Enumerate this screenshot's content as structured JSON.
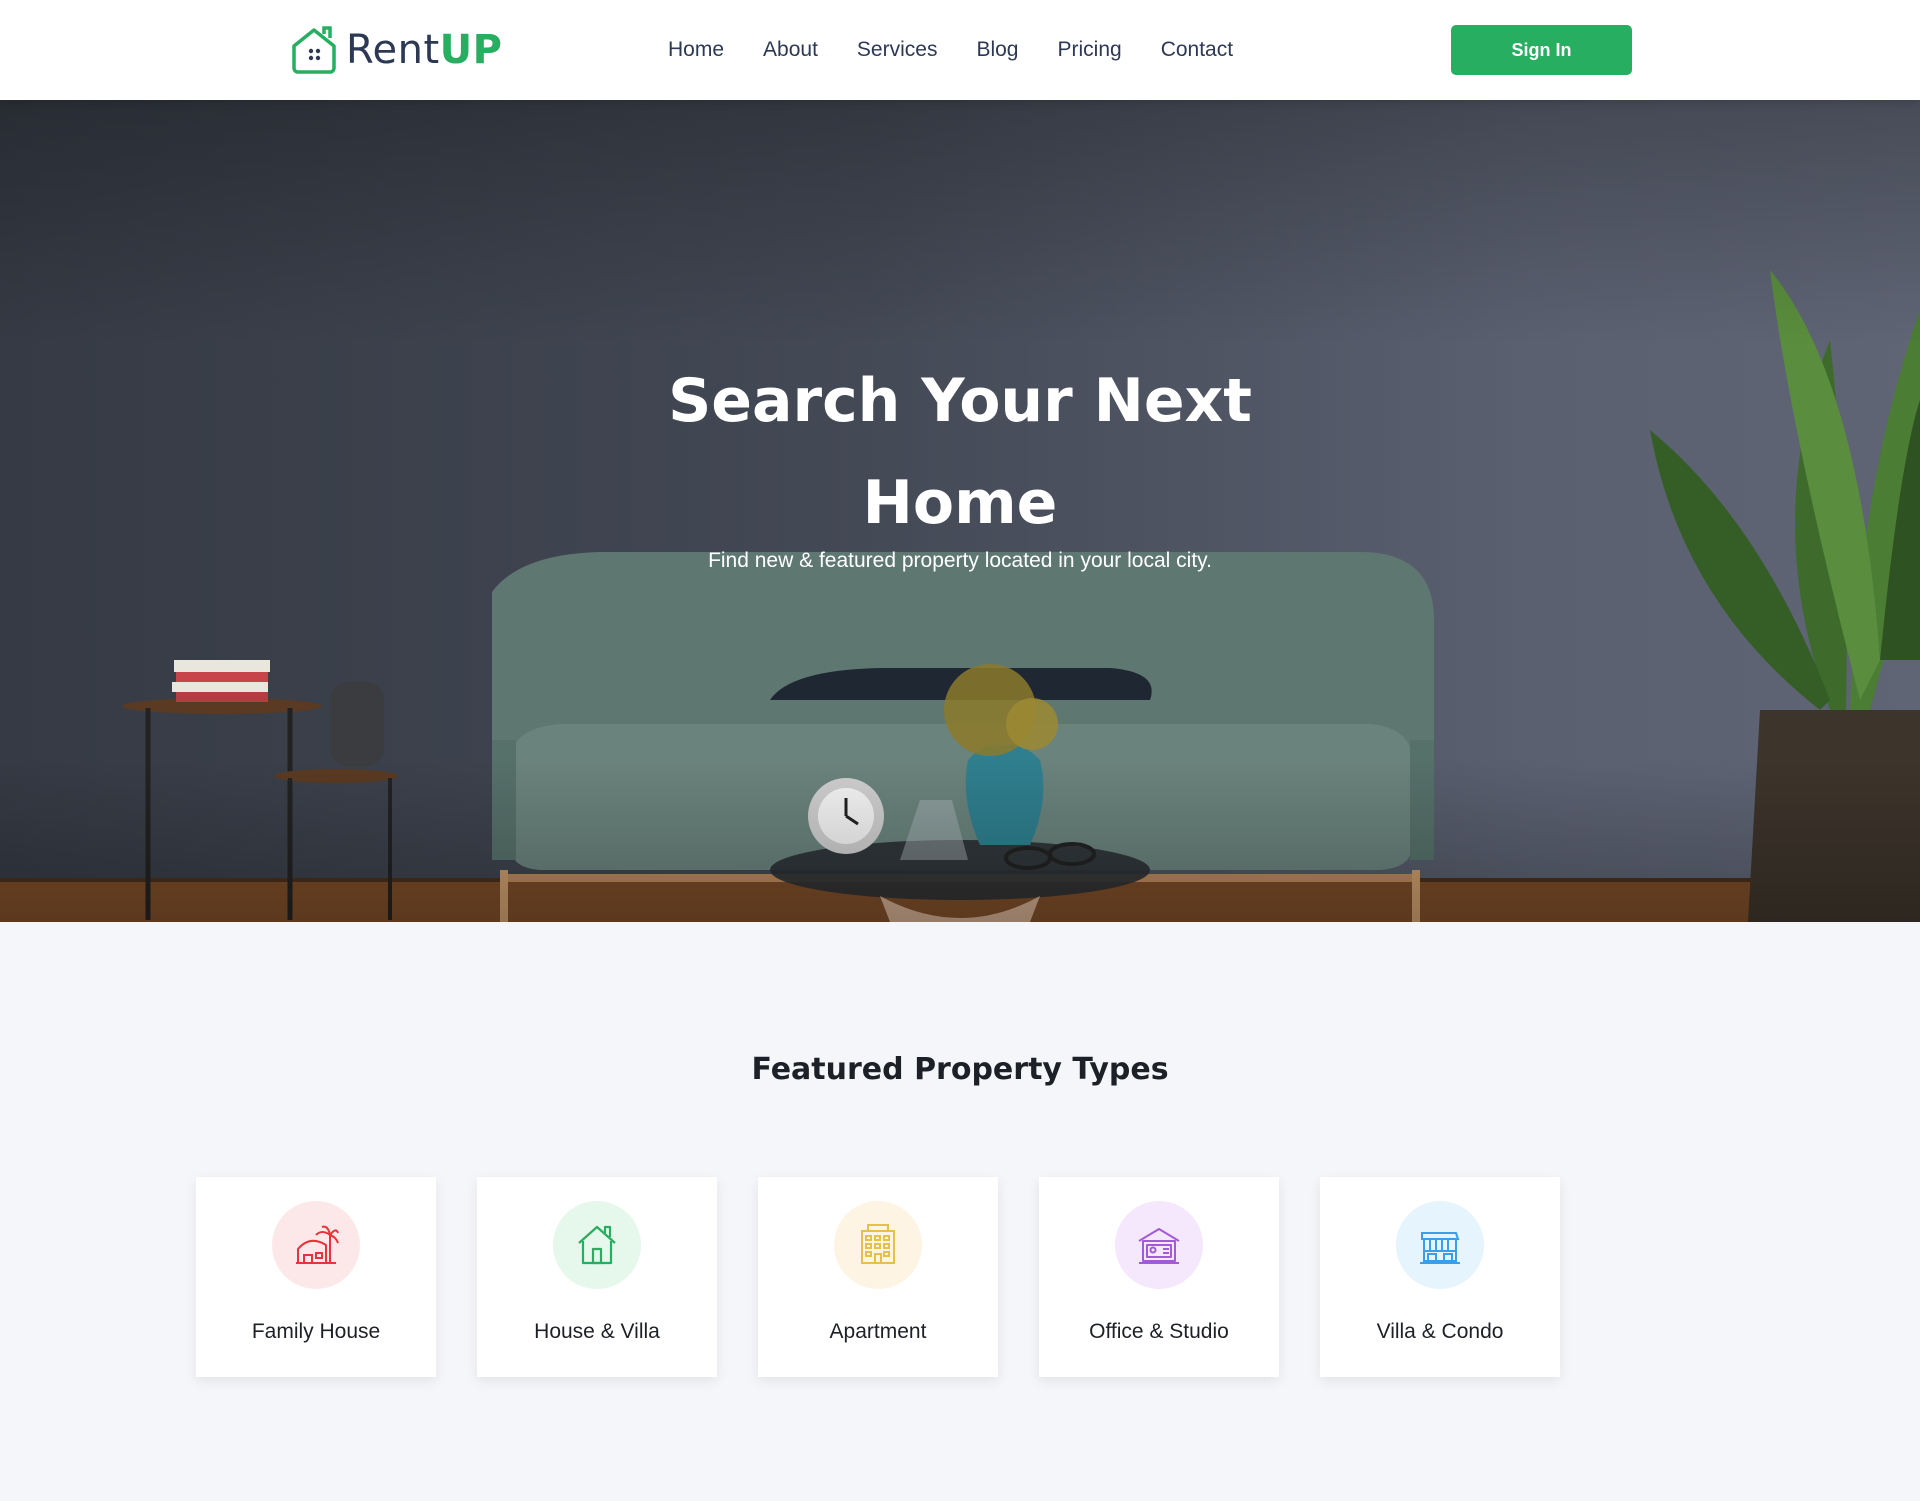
{
  "header": {
    "logo": {
      "text_main": "Rent",
      "text_accent": "UP"
    },
    "nav": [
      {
        "label": "Home"
      },
      {
        "label": "About"
      },
      {
        "label": "Services"
      },
      {
        "label": "Blog"
      },
      {
        "label": "Pricing"
      },
      {
        "label": "Contact"
      }
    ],
    "signin_label": "Sign In"
  },
  "hero": {
    "title": "Search Your Next Home",
    "subtitle": "Find new & featured property located in your local city."
  },
  "featured": {
    "title": "Featured Property Types",
    "items": [
      {
        "label": "Family House",
        "icon": "palm-house-icon",
        "color": "#e8333a",
        "bg": "#fde8e9"
      },
      {
        "label": "House & Villa",
        "icon": "house-icon",
        "color": "#27ae60",
        "bg": "#e6f7ec"
      },
      {
        "label": "Apartment",
        "icon": "apartment-icon",
        "color": "#e6c14a",
        "bg": "#fdf4e3"
      },
      {
        "label": "Office & Studio",
        "icon": "office-icon",
        "color": "#a35ad6",
        "bg": "#f5e8fc"
      },
      {
        "label": "Villa & Condo",
        "icon": "condo-icon",
        "color": "#3a9ee8",
        "bg": "#e6f4fd"
      }
    ]
  },
  "colors": {
    "accent": "#27ae60",
    "heading": "#1d2026",
    "nav_text": "#2d3954",
    "page_bg": "#f5f6fa"
  }
}
